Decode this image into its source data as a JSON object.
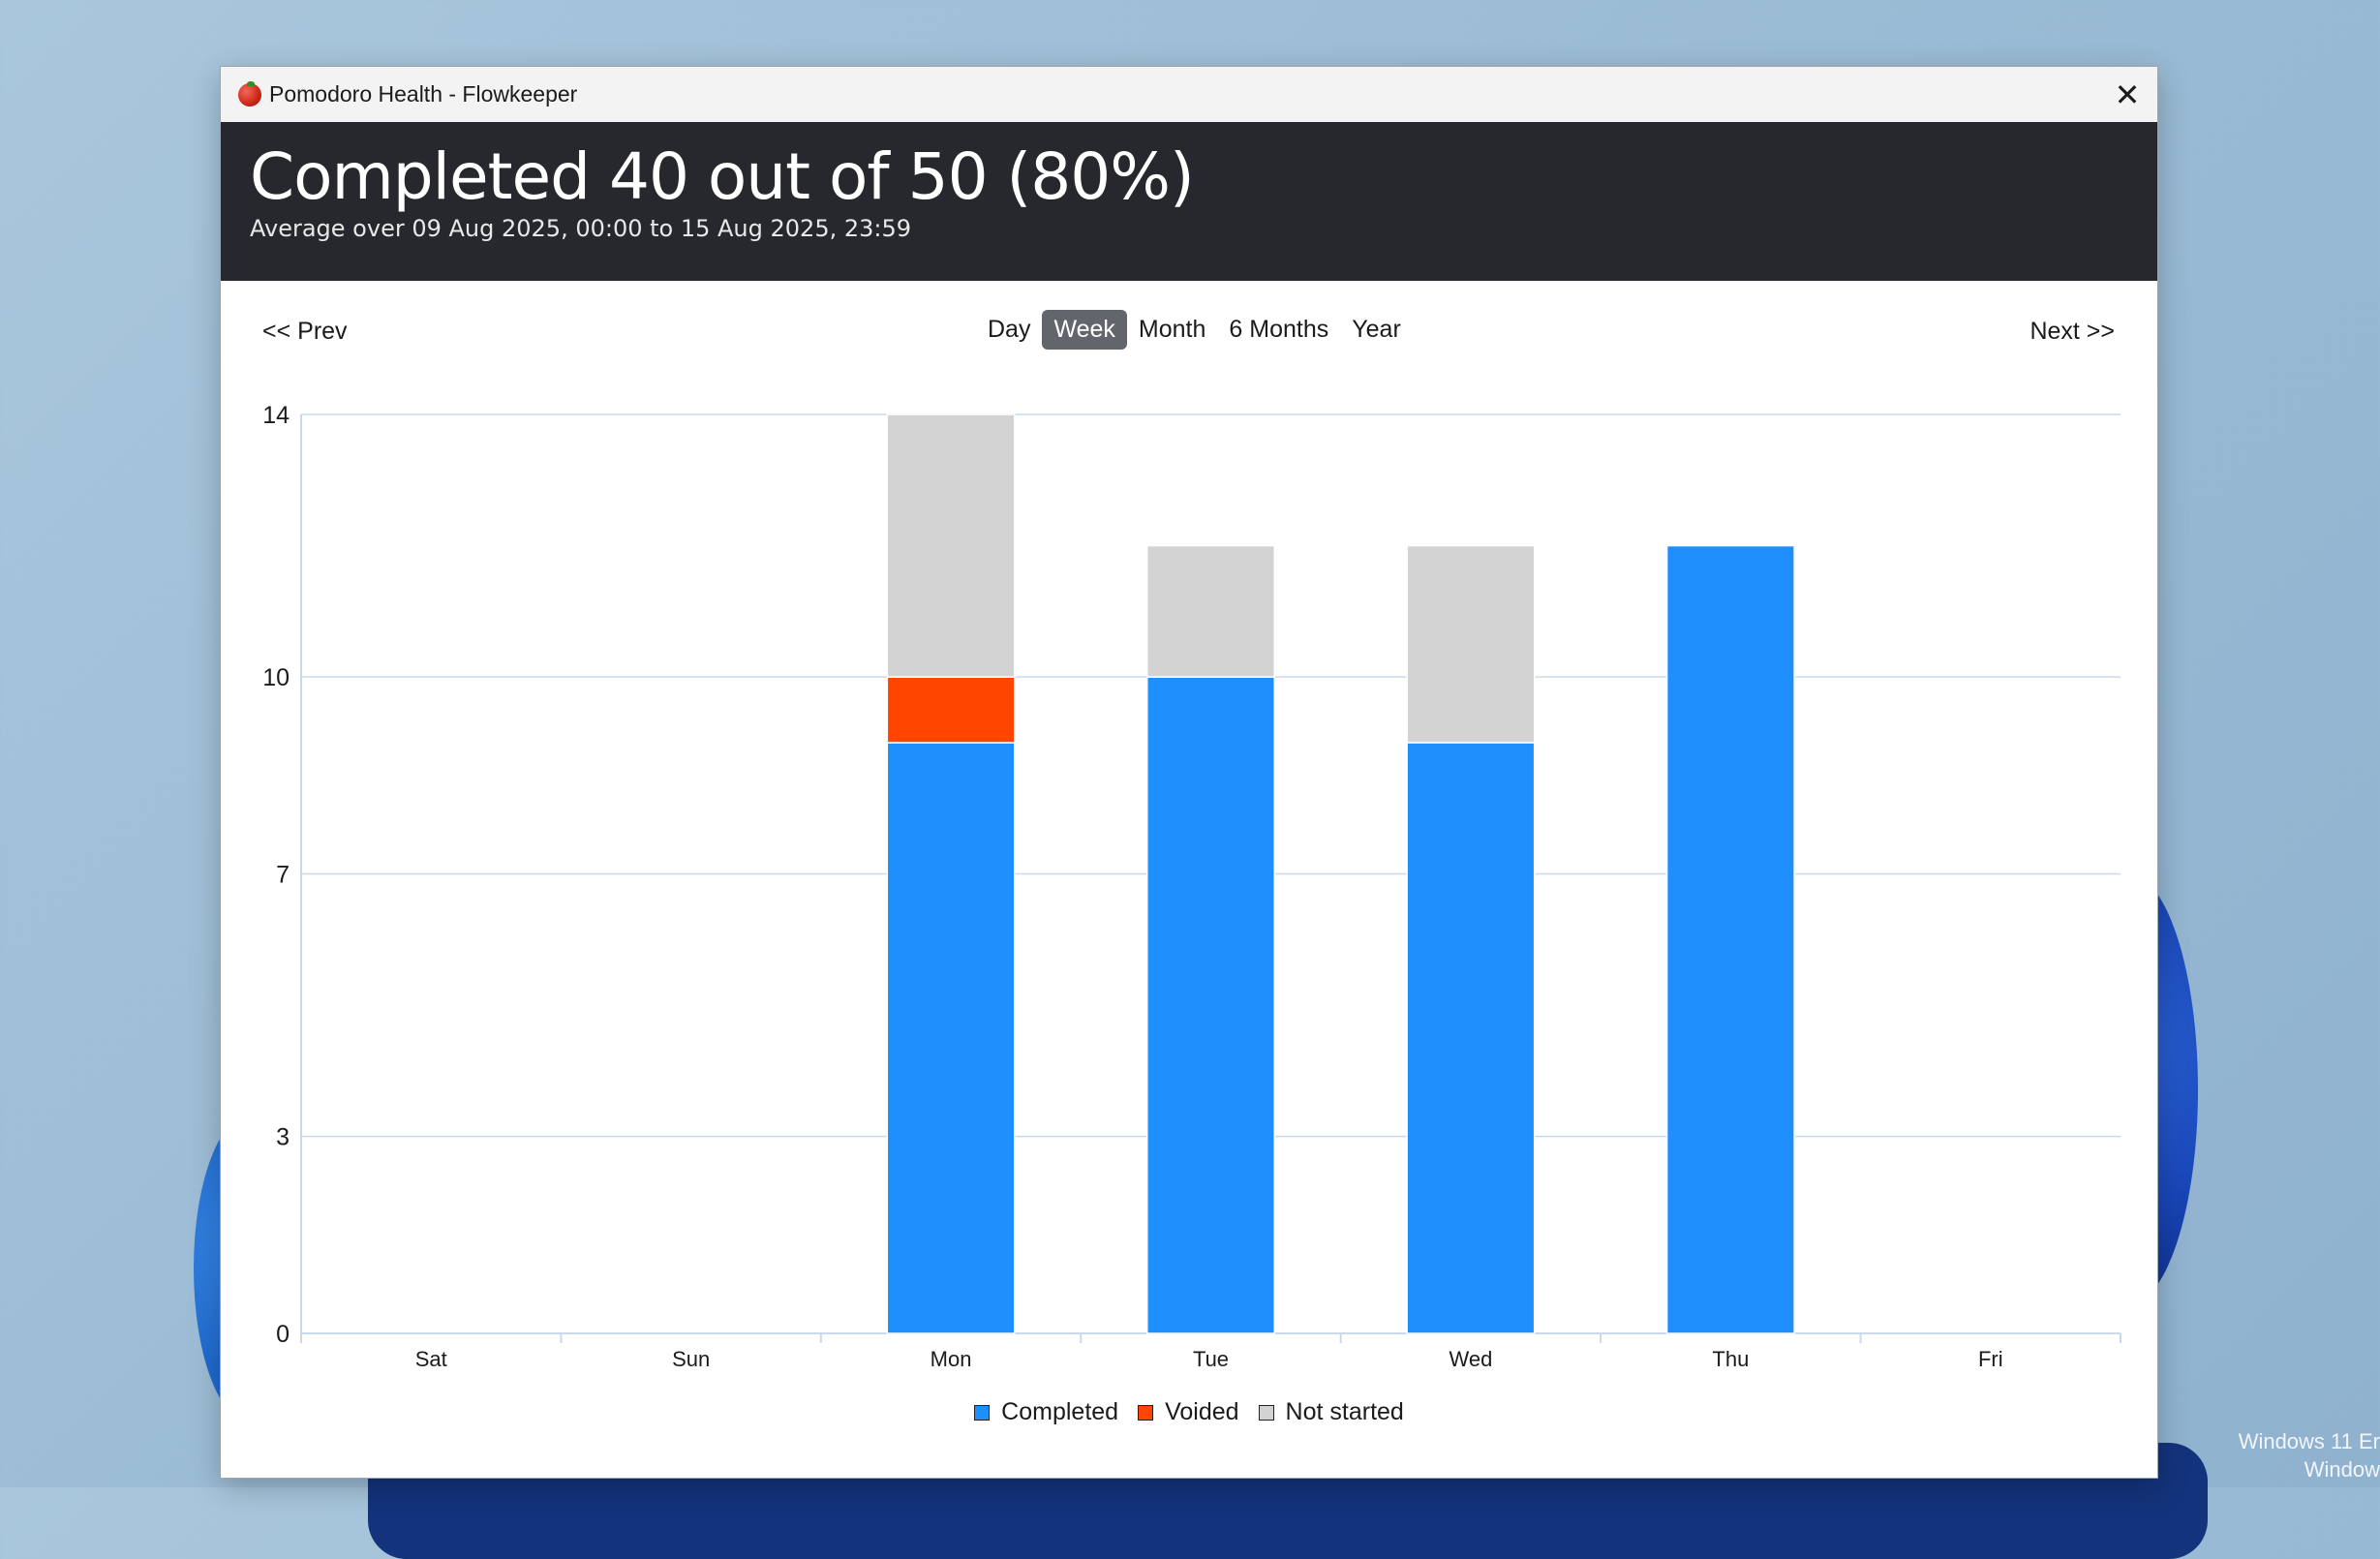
{
  "window": {
    "title": "Pomodoro Health - Flowkeeper",
    "close_symbol": "✕"
  },
  "header": {
    "headline": "Completed 40 out of 50 (80%)",
    "subtitle": "Average over 09 Aug 2025, 00:00 to 15 Aug 2025, 23:59"
  },
  "nav": {
    "prev_label": "<< Prev",
    "next_label": "Next >>",
    "periods": [
      "Day",
      "Week",
      "Month",
      "6 Months",
      "Year"
    ],
    "active_period": "Week"
  },
  "desktop": {
    "watermark_line1": "Windows 11 Er",
    "watermark_line2": "Window"
  },
  "chart_data": {
    "type": "bar",
    "stacked": true,
    "categories": [
      "Sat",
      "Sun",
      "Mon",
      "Tue",
      "Wed",
      "Thu",
      "Fri"
    ],
    "series": [
      {
        "name": "Completed",
        "color": "#1e8ffc",
        "values": [
          0,
          0,
          9,
          10,
          9,
          12,
          0
        ]
      },
      {
        "name": "Voided",
        "color": "#ff4500",
        "values": [
          0,
          0,
          1,
          0,
          0,
          0,
          0
        ]
      },
      {
        "name": "Not started",
        "color": "#d3d3d3",
        "values": [
          0,
          0,
          4,
          2,
          3,
          0,
          0
        ]
      }
    ],
    "yticks": [
      "0",
      "3",
      "7",
      "10",
      "14"
    ],
    "ylim": [
      0,
      14
    ],
    "grid": true,
    "legend_position": "bottom-center"
  }
}
